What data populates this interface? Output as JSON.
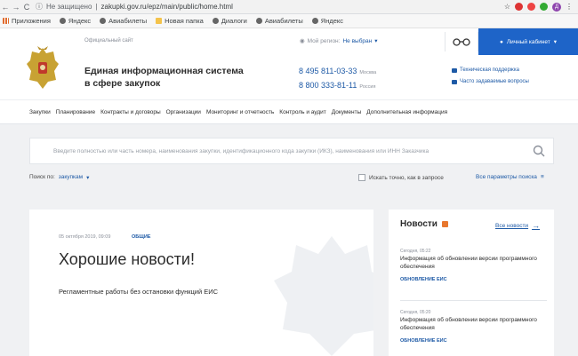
{
  "browser": {
    "back": "←",
    "forward": "→",
    "reload": "C",
    "security": "Не защищено",
    "url": "zakupki.gov.ru/epz/main/public/home.html",
    "profile": "Д"
  },
  "bookmarks": [
    {
      "label": "Приложения",
      "icon": "apps-grid-icon"
    },
    {
      "label": "Яндекс",
      "icon": "globe-icon"
    },
    {
      "label": "Авиабилеты",
      "icon": "globe-icon"
    },
    {
      "label": "Новая папка",
      "icon": "folder-icon"
    },
    {
      "label": "Диалоги",
      "icon": "globe-icon"
    },
    {
      "label": "Авиабилеты",
      "icon": "globe-icon"
    },
    {
      "label": "Яндекс",
      "icon": "globe-icon"
    }
  ],
  "header": {
    "official": "Официальный сайт",
    "region_label": "Мой регион:",
    "region_value": "Не выбран",
    "cabinet": "Личный кабинет",
    "title_line1": "Единая информационная система",
    "title_line2": "в сфере закупок",
    "phone1": "8 495 811-03-33",
    "phone1_label": "Москва",
    "phone2": "8 800 333-81-11",
    "phone2_label": "Россия",
    "support": "Техническая поддержка",
    "faq": "Часто задаваемые вопросы"
  },
  "menu": [
    "Закупки",
    "Планирование",
    "Контракты и договоры",
    "Организации",
    "Мониторинг и отчетность",
    "Контроль и аудит",
    "Документы",
    "Дополнительная информация"
  ],
  "search": {
    "placeholder": "Введите полностью или часть номера, наименования закупки, идентификационного кода закупки (ИКЗ), наименования или ИНН Заказчика",
    "by_label": "Поиск по:",
    "by_value": "закупкам",
    "exact_label": "Искать точно, как в запросе",
    "all_params": "Все параметры поиска"
  },
  "main_card": {
    "date": "05 октября 2019, 09:09",
    "tag": "ОБЩИЕ",
    "title": "Хорошие новости!",
    "text": "Регламентные работы без остановки функций ЕИС"
  },
  "news": {
    "title": "Новости",
    "all_news": "Все новости",
    "items": [
      {
        "date": "Сегодня, 05:22",
        "text": "Информация об обновлении версии программного обеспечения",
        "tag": "ОБНОВЛЕНИЕ ЕИС"
      },
      {
        "date": "Сегодня, 05:20",
        "text": "Информация об обновлении версии программного обеспечения",
        "tag": "ОБНОВЛЕНИЕ ЕИС"
      }
    ]
  }
}
